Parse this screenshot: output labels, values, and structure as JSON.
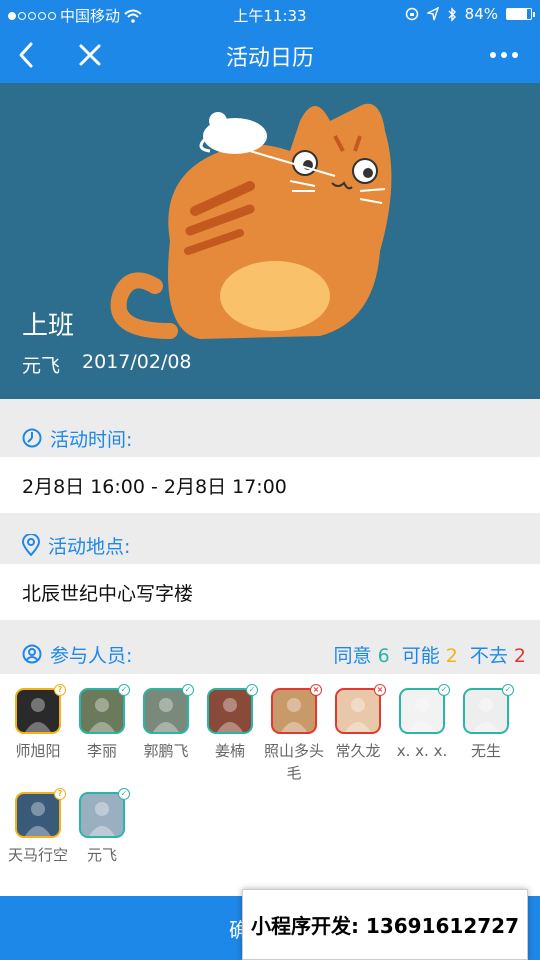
{
  "status": {
    "carrier": "中国移动",
    "time": "上午11:33",
    "battery": "84%",
    "battery_level": 0.84
  },
  "nav": {
    "title": "活动日历"
  },
  "event": {
    "title": "上班",
    "author": "元飞",
    "date": "2017/02/08"
  },
  "time_section": {
    "label": "活动时间:",
    "value": "2月8日 16:00 - 2月8日 17:00"
  },
  "place_section": {
    "label": "活动地点:",
    "value": "北辰世纪中心写字楼"
  },
  "participants": {
    "label": "参与人员:",
    "agree_label": "同意",
    "agree_count": "6",
    "maybe_label": "可能",
    "maybe_count": "2",
    "no_label": "不去",
    "no_count": "2",
    "people": [
      {
        "name": "师旭阳",
        "status": "maybe",
        "color": "#2a2a2a"
      },
      {
        "name": "李丽",
        "status": "agree",
        "color": "#6a7a5a"
      },
      {
        "name": "郭鹏飞",
        "status": "agree",
        "color": "#7a8a7a"
      },
      {
        "name": "姜楠",
        "status": "agree",
        "color": "#8a4a3a"
      },
      {
        "name": "照山多头毛",
        "status": "no",
        "color": "#c89a6a"
      },
      {
        "name": "常久龙",
        "status": "no",
        "color": "#e8c8a8"
      },
      {
        "name": "x. x. x.",
        "status": "agree",
        "color": "#f2f2f2"
      },
      {
        "name": "无生",
        "status": "agree",
        "color": "#eeeeee"
      },
      {
        "name": "天马行空",
        "status": "maybe",
        "color": "#3a5a7a"
      },
      {
        "name": "元飞",
        "status": "agree",
        "color": "#9ab0c0"
      }
    ]
  },
  "footer": {
    "confirm_label": "确",
    "promo_text": "小程序开发: 13691612727"
  },
  "colors": {
    "primary": "#1e88e8",
    "hero_bg": "#2d6e8f",
    "agree": "#2bb5a8",
    "maybe": "#f2b21b",
    "no": "#e03a30"
  }
}
